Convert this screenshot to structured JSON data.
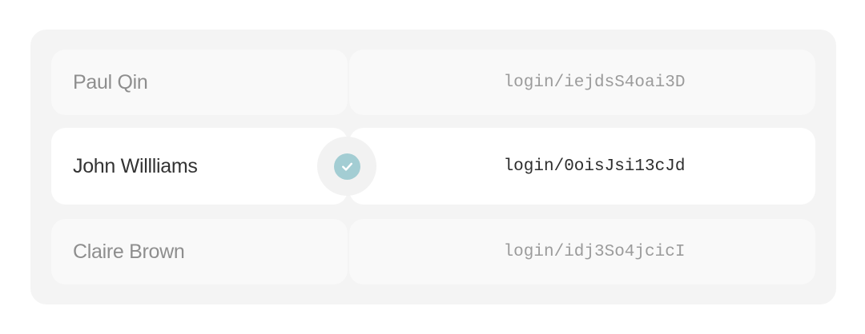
{
  "accounts": [
    {
      "name": "Paul Qin",
      "login": "login/iejdsS4oai3D",
      "selected": false
    },
    {
      "name": "John Willliams",
      "login": "login/0oisJsi13cJd",
      "selected": true
    },
    {
      "name": "Claire Brown",
      "login": "login/idj3So4jcicI",
      "selected": false
    }
  ],
  "selection_indicator": {
    "icon": "check-icon",
    "color": "#a3cdd3"
  }
}
